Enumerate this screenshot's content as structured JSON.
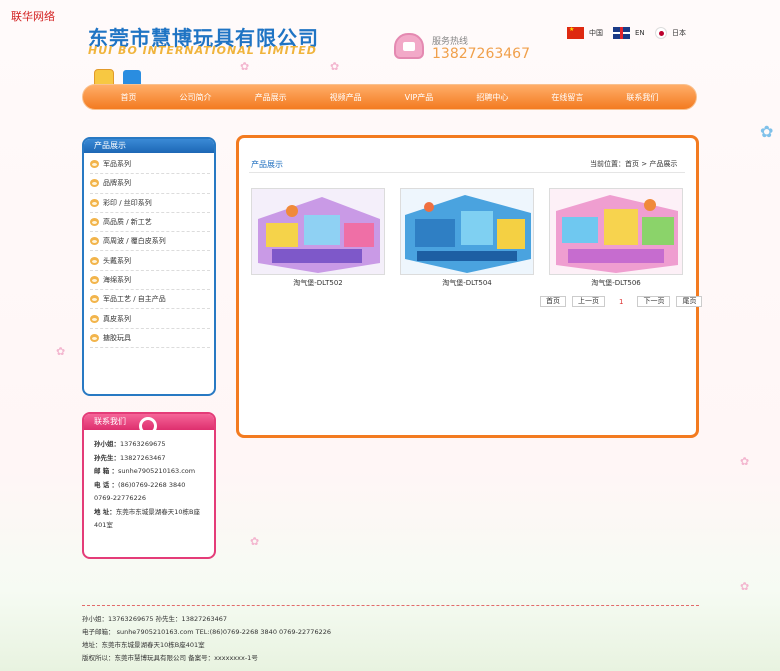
{
  "site_link": "联华网络",
  "logo": {
    "cn": "东莞市慧博玩具有限公司",
    "en": "HUI BO INTERNATIONAL LIMITED"
  },
  "hotline": {
    "label": "服务热线",
    "number": "13827263467"
  },
  "languages": [
    {
      "label": "中国",
      "icon": "china-flag-icon"
    },
    {
      "label": "EN",
      "icon": "uk-flag-icon"
    },
    {
      "label": "日本",
      "icon": "japan-flag-icon"
    }
  ],
  "nav": [
    "首页",
    "公司简介",
    "产品展示",
    "视频产品",
    "VIP产品",
    "招聘中心",
    "在线留言",
    "联系我们"
  ],
  "sidebar": {
    "title": "产品展示",
    "items": [
      "军品系列",
      "品牌系列",
      "彩印 / 丝印系列",
      "高品质 / 新工艺",
      "高周波 / 覆白皮系列",
      "头戴系列",
      "海绵系列",
      "军品工艺 / 自主产品",
      "真皮系列",
      "搪胶玩具"
    ]
  },
  "contact": {
    "title": "联系我们",
    "lines": [
      {
        "k": "孙小姐：",
        "v": "13763269675"
      },
      {
        "k": "孙先生：",
        "v": "13827263467"
      },
      {
        "k": "邮  箱 ：",
        "v": "sunhe7905210163.com"
      },
      {
        "k": "电  话 ：",
        "v": "(86)0769-2268 3840"
      },
      {
        "k": "",
        "v": "0769-22776226"
      },
      {
        "k": "地  址：",
        "v": "东莞市东城景湖春天10栋B座401室"
      }
    ]
  },
  "main": {
    "title": "产品展示",
    "breadcrumb": "当前位置：首页 > 产品展示",
    "products": [
      {
        "caption": "淘气堡-DLT502"
      },
      {
        "caption": "淘气堡-DLT504"
      },
      {
        "caption": "淘气堡-DLT506"
      }
    ],
    "pager": {
      "first": "首页",
      "prev": "上一页",
      "current": "1",
      "next": "下一页",
      "last": "尾页"
    }
  },
  "footer": {
    "line1": "孙小姐：13763269675  孙先生：13827263467",
    "line2": "电子邮箱： sunhe7905210163.com  TEL:(86)0769-2268 3840  0769-22776226",
    "line3": "地址：东莞市东城景湖春天10栋B座401室",
    "line4": "版权所以：东莞市慧博玩具有限公司  备案号：xxxxxxxx-1号"
  },
  "colors": {
    "nav": "#f37b20",
    "sidebar": "#2879c3",
    "contact": "#e43c78",
    "accent": "#f0a04b"
  }
}
